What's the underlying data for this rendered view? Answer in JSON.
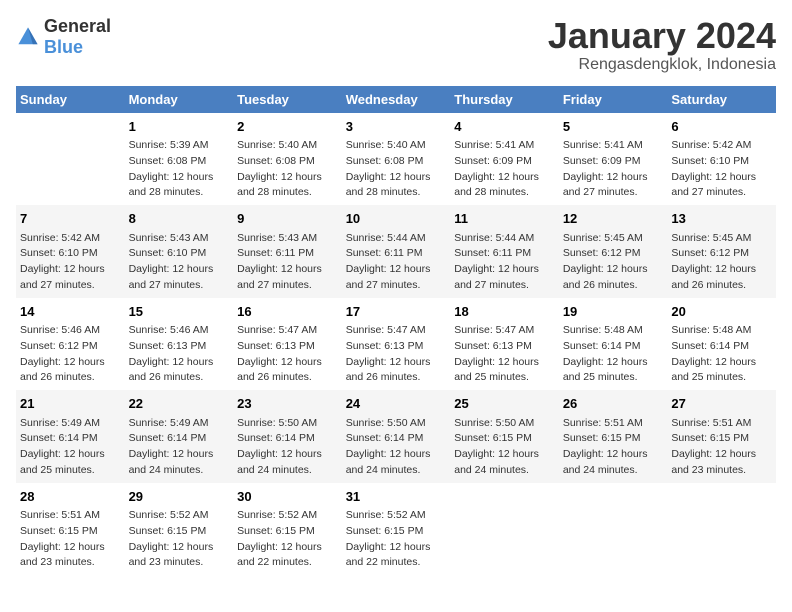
{
  "logo": {
    "general": "General",
    "blue": "Blue"
  },
  "header": {
    "month": "January 2024",
    "location": "Rengasdengklok, Indonesia"
  },
  "weekdays": [
    "Sunday",
    "Monday",
    "Tuesday",
    "Wednesday",
    "Thursday",
    "Friday",
    "Saturday"
  ],
  "weeks": [
    [
      {
        "day": "",
        "content": ""
      },
      {
        "day": "1",
        "content": "Sunrise: 5:39 AM\nSunset: 6:08 PM\nDaylight: 12 hours\nand 28 minutes."
      },
      {
        "day": "2",
        "content": "Sunrise: 5:40 AM\nSunset: 6:08 PM\nDaylight: 12 hours\nand 28 minutes."
      },
      {
        "day": "3",
        "content": "Sunrise: 5:40 AM\nSunset: 6:08 PM\nDaylight: 12 hours\nand 28 minutes."
      },
      {
        "day": "4",
        "content": "Sunrise: 5:41 AM\nSunset: 6:09 PM\nDaylight: 12 hours\nand 28 minutes."
      },
      {
        "day": "5",
        "content": "Sunrise: 5:41 AM\nSunset: 6:09 PM\nDaylight: 12 hours\nand 27 minutes."
      },
      {
        "day": "6",
        "content": "Sunrise: 5:42 AM\nSunset: 6:10 PM\nDaylight: 12 hours\nand 27 minutes."
      }
    ],
    [
      {
        "day": "7",
        "content": "Sunrise: 5:42 AM\nSunset: 6:10 PM\nDaylight: 12 hours\nand 27 minutes."
      },
      {
        "day": "8",
        "content": "Sunrise: 5:43 AM\nSunset: 6:10 PM\nDaylight: 12 hours\nand 27 minutes."
      },
      {
        "day": "9",
        "content": "Sunrise: 5:43 AM\nSunset: 6:11 PM\nDaylight: 12 hours\nand 27 minutes."
      },
      {
        "day": "10",
        "content": "Sunrise: 5:44 AM\nSunset: 6:11 PM\nDaylight: 12 hours\nand 27 minutes."
      },
      {
        "day": "11",
        "content": "Sunrise: 5:44 AM\nSunset: 6:11 PM\nDaylight: 12 hours\nand 27 minutes."
      },
      {
        "day": "12",
        "content": "Sunrise: 5:45 AM\nSunset: 6:12 PM\nDaylight: 12 hours\nand 26 minutes."
      },
      {
        "day": "13",
        "content": "Sunrise: 5:45 AM\nSunset: 6:12 PM\nDaylight: 12 hours\nand 26 minutes."
      }
    ],
    [
      {
        "day": "14",
        "content": "Sunrise: 5:46 AM\nSunset: 6:12 PM\nDaylight: 12 hours\nand 26 minutes."
      },
      {
        "day": "15",
        "content": "Sunrise: 5:46 AM\nSunset: 6:13 PM\nDaylight: 12 hours\nand 26 minutes."
      },
      {
        "day": "16",
        "content": "Sunrise: 5:47 AM\nSunset: 6:13 PM\nDaylight: 12 hours\nand 26 minutes."
      },
      {
        "day": "17",
        "content": "Sunrise: 5:47 AM\nSunset: 6:13 PM\nDaylight: 12 hours\nand 26 minutes."
      },
      {
        "day": "18",
        "content": "Sunrise: 5:47 AM\nSunset: 6:13 PM\nDaylight: 12 hours\nand 25 minutes."
      },
      {
        "day": "19",
        "content": "Sunrise: 5:48 AM\nSunset: 6:14 PM\nDaylight: 12 hours\nand 25 minutes."
      },
      {
        "day": "20",
        "content": "Sunrise: 5:48 AM\nSunset: 6:14 PM\nDaylight: 12 hours\nand 25 minutes."
      }
    ],
    [
      {
        "day": "21",
        "content": "Sunrise: 5:49 AM\nSunset: 6:14 PM\nDaylight: 12 hours\nand 25 minutes."
      },
      {
        "day": "22",
        "content": "Sunrise: 5:49 AM\nSunset: 6:14 PM\nDaylight: 12 hours\nand 24 minutes."
      },
      {
        "day": "23",
        "content": "Sunrise: 5:50 AM\nSunset: 6:14 PM\nDaylight: 12 hours\nand 24 minutes."
      },
      {
        "day": "24",
        "content": "Sunrise: 5:50 AM\nSunset: 6:14 PM\nDaylight: 12 hours\nand 24 minutes."
      },
      {
        "day": "25",
        "content": "Sunrise: 5:50 AM\nSunset: 6:15 PM\nDaylight: 12 hours\nand 24 minutes."
      },
      {
        "day": "26",
        "content": "Sunrise: 5:51 AM\nSunset: 6:15 PM\nDaylight: 12 hours\nand 24 minutes."
      },
      {
        "day": "27",
        "content": "Sunrise: 5:51 AM\nSunset: 6:15 PM\nDaylight: 12 hours\nand 23 minutes."
      }
    ],
    [
      {
        "day": "28",
        "content": "Sunrise: 5:51 AM\nSunset: 6:15 PM\nDaylight: 12 hours\nand 23 minutes."
      },
      {
        "day": "29",
        "content": "Sunrise: 5:52 AM\nSunset: 6:15 PM\nDaylight: 12 hours\nand 23 minutes."
      },
      {
        "day": "30",
        "content": "Sunrise: 5:52 AM\nSunset: 6:15 PM\nDaylight: 12 hours\nand 22 minutes."
      },
      {
        "day": "31",
        "content": "Sunrise: 5:52 AM\nSunset: 6:15 PM\nDaylight: 12 hours\nand 22 minutes."
      },
      {
        "day": "",
        "content": ""
      },
      {
        "day": "",
        "content": ""
      },
      {
        "day": "",
        "content": ""
      }
    ]
  ]
}
